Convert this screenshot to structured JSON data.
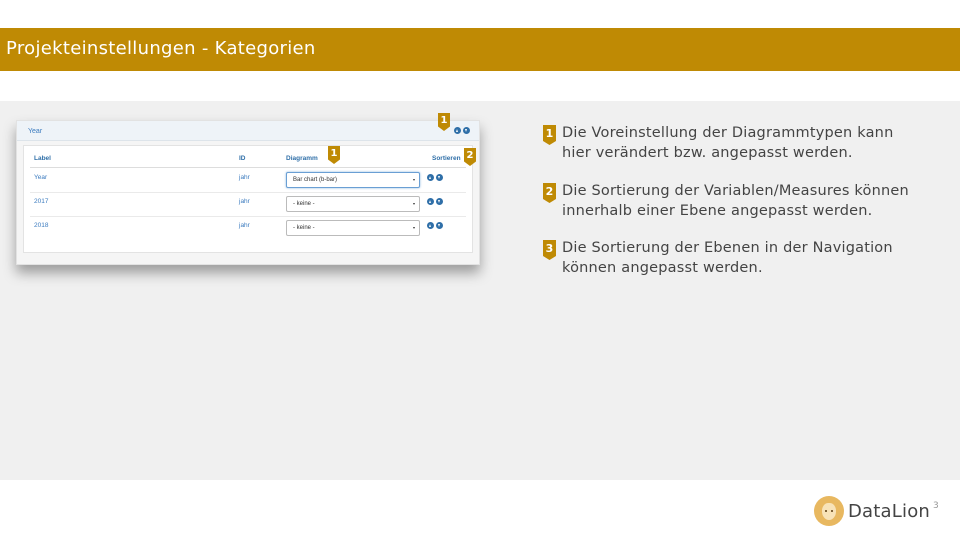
{
  "header": {
    "title": "Projekteinstellungen - Kategorien"
  },
  "panel": {
    "title": "Year",
    "table": {
      "columns": [
        "Label",
        "ID",
        "Diagramm",
        "Sortieren"
      ],
      "rows": [
        {
          "label": "Year",
          "id": "jahr",
          "diagramm": "Bar chart (b-bar)"
        },
        {
          "label": "2017",
          "id": "jahr",
          "diagramm": "- keine -"
        },
        {
          "label": "2018",
          "id": "jahr",
          "diagramm": "- keine -"
        }
      ]
    }
  },
  "markers": {
    "m1": "1",
    "m2": "2"
  },
  "descriptions": [
    {
      "number": "1",
      "text": "Die Voreinstellung der Diagrammtypen kann hier verändert bzw. angepasst werden."
    },
    {
      "number": "2",
      "text": "Die Sortierung der Variablen/Measures können innerhalb einer Ebene angepasst werden."
    },
    {
      "number": "3",
      "text": "Die Sortierung der Ebenen in der Navigation können angepasst werden."
    }
  ],
  "footer": {
    "logo_text": "DataLion",
    "page_number": "3"
  },
  "colors": {
    "accent": "#bf8a04",
    "link": "#3b7bbf",
    "icon": "#2f6fa8"
  },
  "icons": {
    "sort_up": "arrow-up-circle-icon",
    "sort_down": "arrow-down-circle-icon",
    "logo": "lion-icon"
  }
}
